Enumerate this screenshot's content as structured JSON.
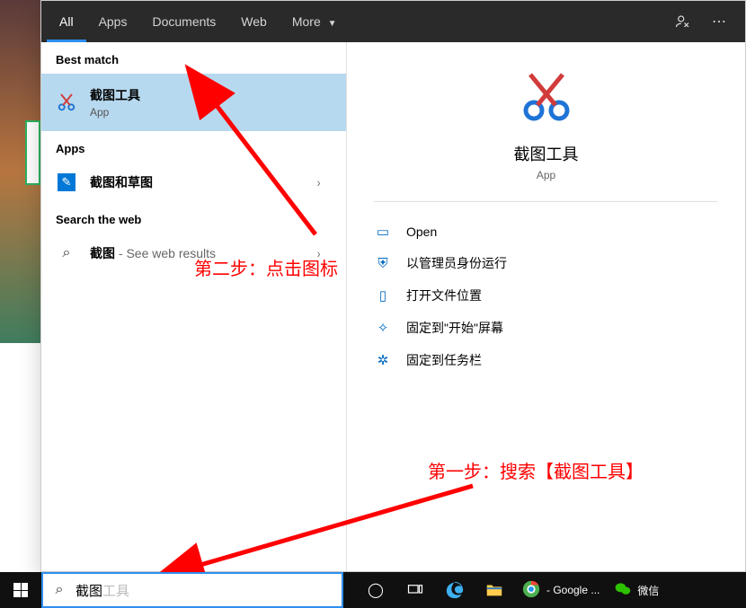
{
  "tabs": {
    "all": "All",
    "apps": "Apps",
    "documents": "Documents",
    "web": "Web",
    "more": "More"
  },
  "sections": {
    "best_match": "Best match",
    "apps": "Apps",
    "search_web": "Search the web"
  },
  "best": {
    "title": "截图工具",
    "sub": "App"
  },
  "app_result": {
    "title": "截图和草图"
  },
  "web_result": {
    "query": "截图",
    "suffix": " - See web results"
  },
  "preview": {
    "title": "截图工具",
    "sub": "App"
  },
  "actions": {
    "open": "Open",
    "admin": "以管理员身份运行",
    "location": "打开文件位置",
    "pin_start": "固定到\"开始\"屏幕",
    "pin_taskbar": "固定到任务栏"
  },
  "annotations": {
    "step1": "第一步：搜索【截图工具】",
    "step2": "第二步：点击图标"
  },
  "searchbox": {
    "typed": "截图",
    "ghost": "工具"
  },
  "taskbar": {
    "chrome_label": " - Google ...",
    "wechat": "微信"
  }
}
